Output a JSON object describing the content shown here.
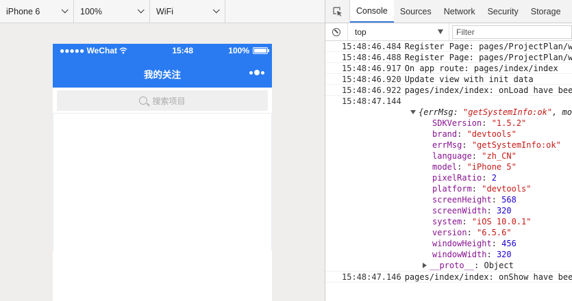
{
  "simulator": {
    "toolbar": {
      "device": "iPhone 6",
      "zoom": "100%",
      "network": "WiFi"
    },
    "status_bar": {
      "carrier": "●●●●● WeChat",
      "time": "15:48",
      "battery": "100%"
    },
    "nav": {
      "title": "我的关注"
    },
    "search": {
      "placeholder": "搜索项目"
    }
  },
  "devtools": {
    "tabs": [
      "Console",
      "Sources",
      "Network",
      "Security",
      "Storage"
    ],
    "active_tab": "Console",
    "context": "top",
    "filter_placeholder": "Filter",
    "logs": [
      {
        "ts": "15:48:46.484",
        "msg": "Register Page: pages/ProjectPlan/w"
      },
      {
        "ts": "15:48:46.488",
        "msg": "Register Page: pages/ProjectPlan/w"
      },
      {
        "ts": "15:48:46.917",
        "msg": "On app route: pages/index/index"
      },
      {
        "ts": "15:48:46.920",
        "msg": "Update view with init data"
      },
      {
        "ts": "15:48:46.922",
        "msg": "pages/index/index: onLoad have bee"
      },
      {
        "ts": "15:48:47.144",
        "msg": ""
      },
      {
        "ts": "15:48:47.146",
        "msg": "pages/index/index: onShow have bee"
      }
    ],
    "object": {
      "summary_open": "{errMsg: ",
      "summary_val": "\"getSystemInfo:ok\"",
      "summary_rest": ", mod",
      "props": [
        {
          "key": "SDKVersion",
          "value": "\"1.5.2\"",
          "kind": "string"
        },
        {
          "key": "brand",
          "value": "\"devtools\"",
          "kind": "string"
        },
        {
          "key": "errMsg",
          "value": "\"getSystemInfo:ok\"",
          "kind": "string"
        },
        {
          "key": "language",
          "value": "\"zh_CN\"",
          "kind": "string"
        },
        {
          "key": "model",
          "value": "\"iPhone 5\"",
          "kind": "string"
        },
        {
          "key": "pixelRatio",
          "value": "2",
          "kind": "number"
        },
        {
          "key": "platform",
          "value": "\"devtools\"",
          "kind": "string"
        },
        {
          "key": "screenHeight",
          "value": "568",
          "kind": "number"
        },
        {
          "key": "screenWidth",
          "value": "320",
          "kind": "number"
        },
        {
          "key": "system",
          "value": "\"iOS 10.0.1\"",
          "kind": "string"
        },
        {
          "key": "version",
          "value": "\"6.5.6\"",
          "kind": "string"
        },
        {
          "key": "windowHeight",
          "value": "456",
          "kind": "number"
        },
        {
          "key": "windowWidth",
          "value": "320",
          "kind": "number"
        }
      ],
      "proto_key": "__proto__",
      "proto_value": "Object"
    }
  }
}
